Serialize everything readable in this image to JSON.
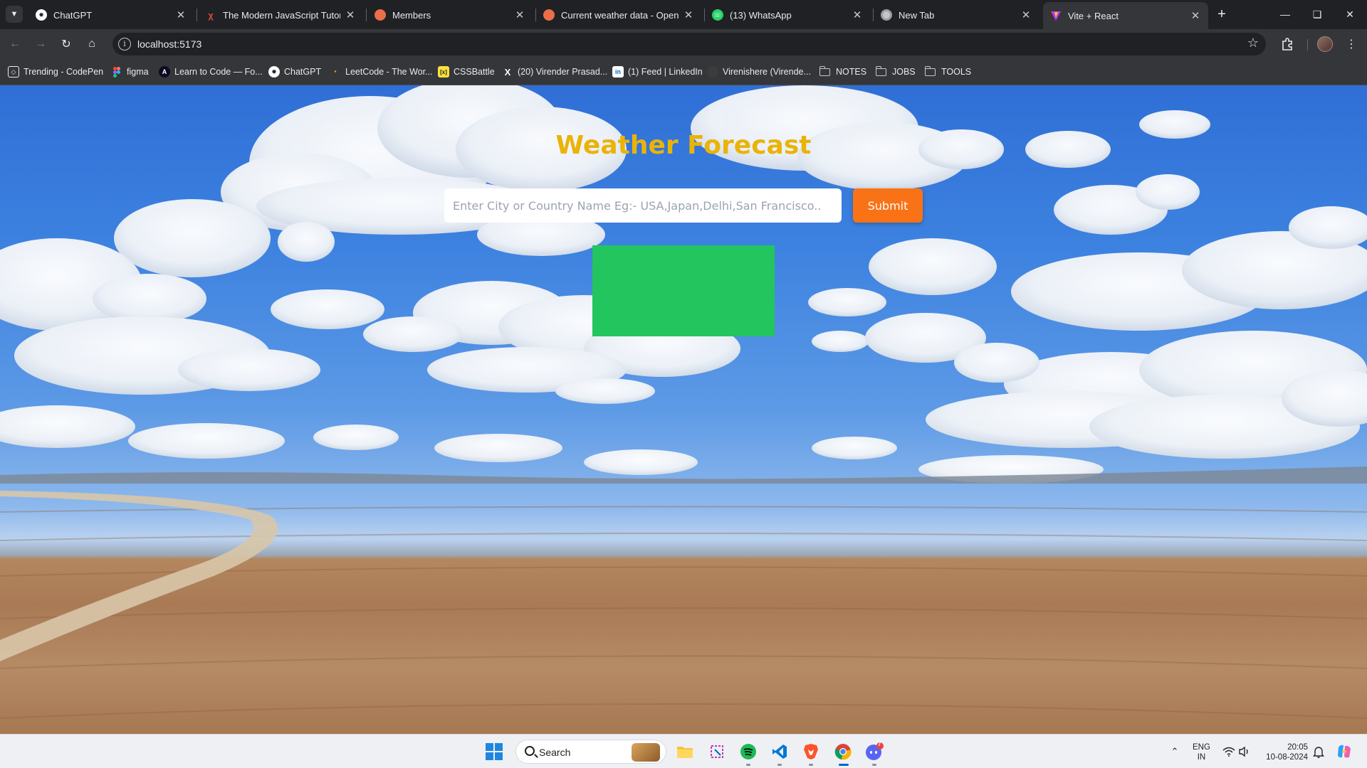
{
  "browser": {
    "tabs": [
      {
        "title": "ChatGPT",
        "icon": "chatgpt-icon",
        "color": "#ffffff"
      },
      {
        "title": "The Modern JavaScript Tutorial",
        "icon": "javascript-info-icon",
        "color": "#dd4b39"
      },
      {
        "title": "Members",
        "icon": "openweather-icon",
        "color": "#eb6e4b"
      },
      {
        "title": "Current weather data - OpenWe",
        "icon": "openweather-icon",
        "color": "#eb6e4b"
      },
      {
        "title": "(13) WhatsApp",
        "icon": "whatsapp-icon",
        "color": "#25d366"
      },
      {
        "title": "New Tab",
        "icon": "chrome-icon",
        "color": "#c4c7c5"
      },
      {
        "title": "Vite + React",
        "icon": "vite-icon",
        "color": "#bd34fe",
        "active": true
      }
    ],
    "url": "localhost:5173",
    "bookmarks": [
      {
        "label": "Trending - CodePen",
        "icon": "codepen-icon"
      },
      {
        "label": "figma",
        "icon": "figma-icon"
      },
      {
        "label": "Learn to Code — Fo...",
        "icon": "freecodecamp-icon"
      },
      {
        "label": "ChatGPT",
        "icon": "chatgpt-icon"
      },
      {
        "label": "LeetCode - The Wor...",
        "icon": "leetcode-icon"
      },
      {
        "label": "CSSBattle",
        "icon": "cssbattle-icon"
      },
      {
        "label": "(20) Virender Prasad...",
        "icon": "x-twitter-icon"
      },
      {
        "label": "(1) Feed | LinkedIn",
        "icon": "linkedin-icon"
      },
      {
        "label": "Virenishere (Virende...",
        "icon": "github-icon"
      },
      {
        "label": "NOTES",
        "icon": "folder-icon"
      },
      {
        "label": "JOBS",
        "icon": "folder-icon"
      },
      {
        "label": "TOOLS",
        "icon": "folder-icon"
      }
    ]
  },
  "app": {
    "title": "Weather Forecast",
    "search_placeholder": "Enter City or Country Name Eg:- USA,Japan,Delhi,San Francisco..",
    "search_value": "",
    "submit_label": "Submit",
    "colors": {
      "title": "#eab308",
      "submit": "#f97316",
      "result_box": "#22c55e"
    }
  },
  "taskbar": {
    "search_label": "Search",
    "apps": [
      "start-icon",
      "file-explorer-icon",
      "snipping-tool-icon",
      "spotify-icon",
      "vscode-icon",
      "brave-icon",
      "chrome-icon",
      "discord-icon"
    ],
    "language": "ENG",
    "region": "IN",
    "time": "20:05",
    "date": "10-08-2024",
    "discord_badge": "7"
  }
}
